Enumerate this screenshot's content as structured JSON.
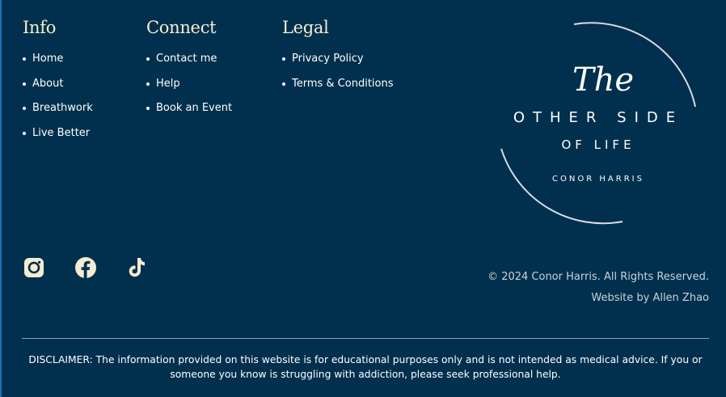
{
  "columns": {
    "info": {
      "title": "Info",
      "items": [
        "Home",
        "About",
        "Breathwork",
        "Live Better"
      ]
    },
    "connect": {
      "title": "Connect",
      "items": [
        "Contact me",
        "Help",
        "Book an Event"
      ]
    },
    "legal": {
      "title": "Legal",
      "items": [
        "Privacy Policy",
        "Terms & Conditions"
      ]
    }
  },
  "logo": {
    "script": "The",
    "line1": "OTHER SIDE",
    "line2": "OF LIFE",
    "name": "CONOR HARRIS"
  },
  "social": [
    "instagram-icon",
    "facebook-icon",
    "tiktok-icon"
  ],
  "footer": {
    "copyright": "© 2024 Conor Harris. All Rights Reserved.",
    "credit": "Website by Allen Zhao",
    "disclaimer": "DISCLAIMER: The information provided on this website is for educational purposes only and is not intended as medical advice. If you or someone you know is struggling with addiction, please seek professional help."
  },
  "colors": {
    "background": "#00304d",
    "accent": "#f6ecd2",
    "text": "#ffffff",
    "muted": "#c9d3da"
  }
}
